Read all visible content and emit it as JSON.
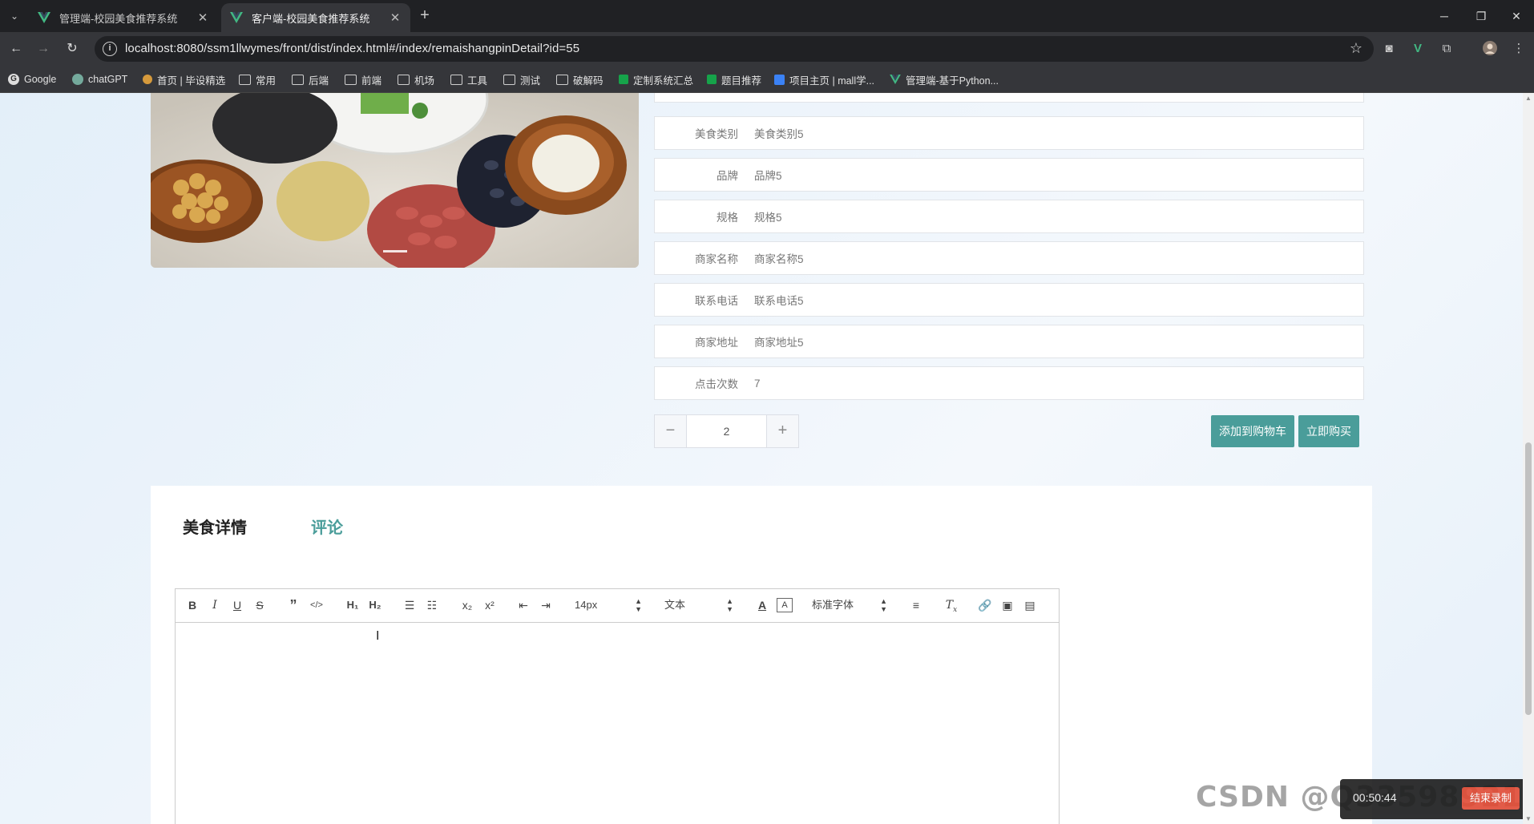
{
  "browser": {
    "tabs": [
      {
        "title": "管理端-校园美食推荐系统",
        "active": false
      },
      {
        "title": "客户端-校园美食推荐系统",
        "active": true
      }
    ],
    "url": "localhost:8080/ssm1llwymes/front/dist/index.html#/index/remaishangpinDetail?id=55",
    "bookmarks": [
      {
        "label": "Google",
        "icon": "google-icon"
      },
      {
        "label": "chatGPT",
        "icon": "chatgpt-icon"
      },
      {
        "label": "首页 | 毕设精选",
        "icon": "site-icon"
      },
      {
        "label": "常用",
        "icon": "folder-icon"
      },
      {
        "label": "后端",
        "icon": "folder-icon"
      },
      {
        "label": "前端",
        "icon": "folder-icon"
      },
      {
        "label": "机场",
        "icon": "folder-icon"
      },
      {
        "label": "工具",
        "icon": "folder-icon"
      },
      {
        "label": "测试",
        "icon": "folder-icon"
      },
      {
        "label": "破解码",
        "icon": "folder-icon"
      },
      {
        "label": "定制系统汇总",
        "icon": "sheet-icon"
      },
      {
        "label": "题目推荐",
        "icon": "sheet-icon"
      },
      {
        "label": "项目主页 | mall学...",
        "icon": "page-icon"
      },
      {
        "label": "管理端-基于Python...",
        "icon": "vue-icon"
      }
    ]
  },
  "product": {
    "fields": [
      {
        "label": "美食类别",
        "value": "美食类别5"
      },
      {
        "label": "品牌",
        "value": "品牌5"
      },
      {
        "label": "规格",
        "value": "规格5"
      },
      {
        "label": "商家名称",
        "value": "商家名称5"
      },
      {
        "label": "联系电话",
        "value": "联系电话5"
      },
      {
        "label": "商家地址",
        "value": "商家地址5"
      },
      {
        "label": "点击次数",
        "value": "7"
      }
    ],
    "quantity": "2",
    "add_to_cart": "添加到购物车",
    "buy_now": "立即购买"
  },
  "detail": {
    "tabs": [
      "美食详情",
      "评论"
    ],
    "editor": {
      "font_size": "14px",
      "text_type": "文本",
      "font_family": "标准字体"
    }
  },
  "watermark": "CSDN @Q3359892174",
  "recorder": {
    "time": "00:50:44",
    "stop_label": "结束录制"
  },
  "colors": {
    "accent": "#4a9d9a"
  }
}
